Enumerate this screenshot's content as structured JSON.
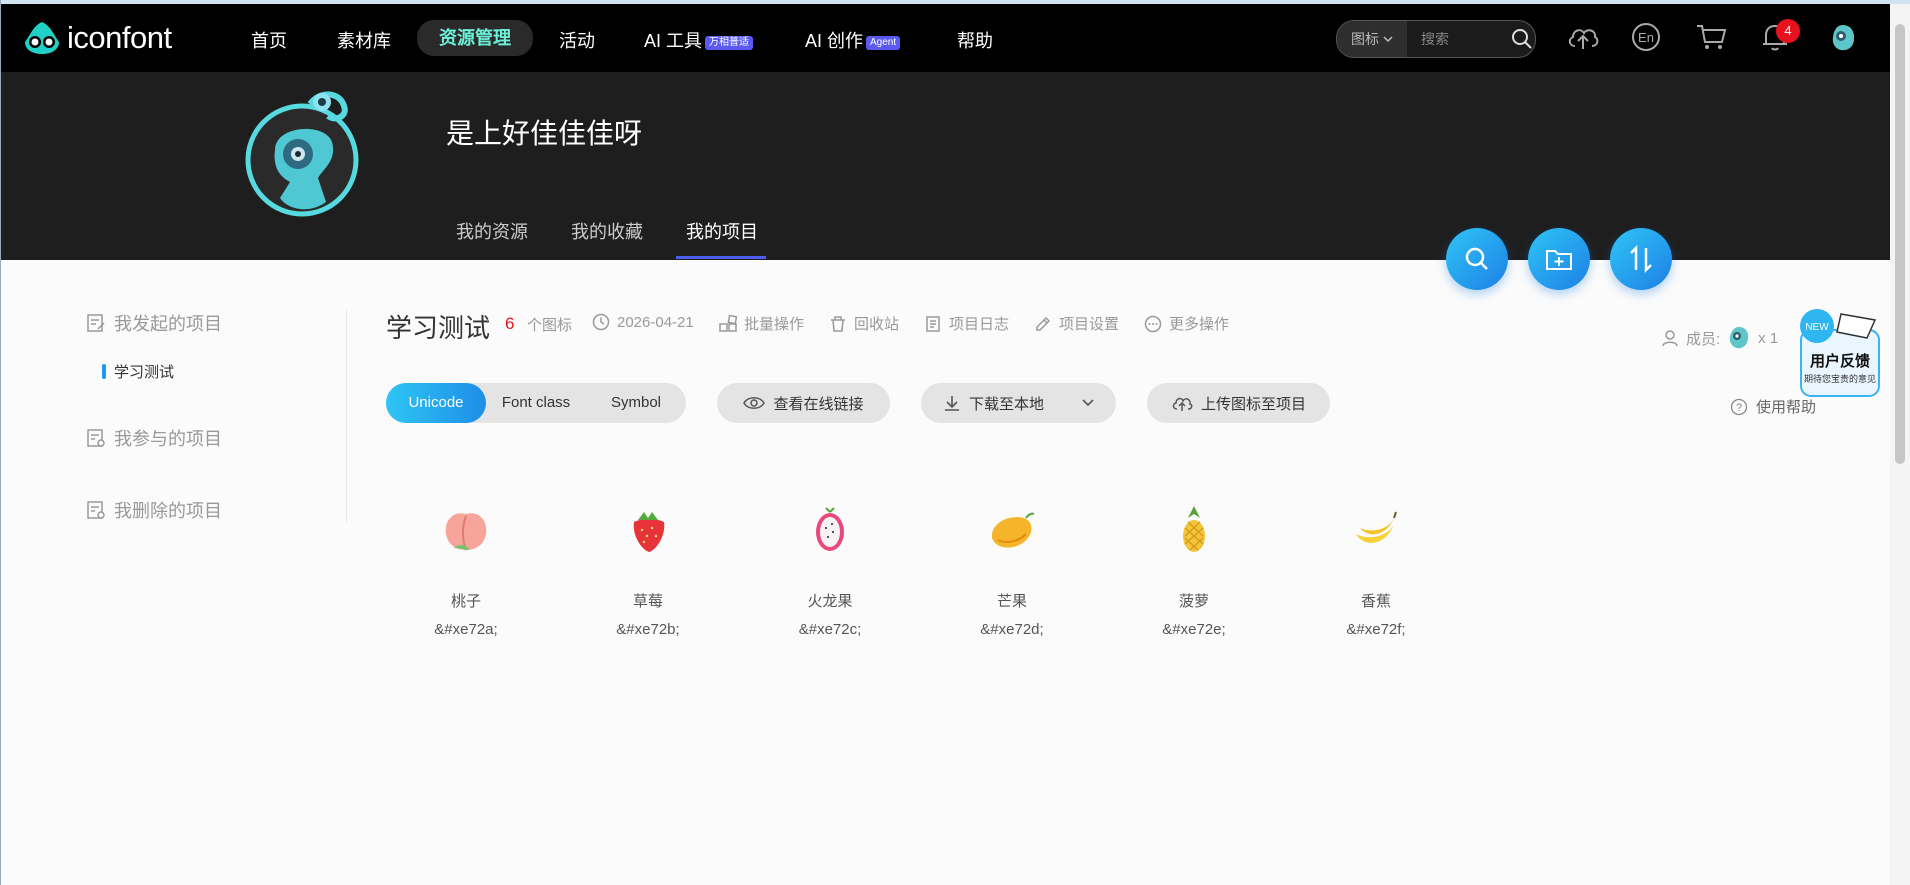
{
  "nav": {
    "logo_text": "iconfont",
    "items": [
      {
        "label": "首页"
      },
      {
        "label": "素材库"
      },
      {
        "label": "资源管理"
      },
      {
        "label": "活动"
      },
      {
        "label": "AI 工具",
        "badge": "万相普适"
      },
      {
        "label": "AI 创作",
        "badge": "Agent"
      },
      {
        "label": "帮助"
      }
    ],
    "search": {
      "type": "图标",
      "placeholder": "搜索"
    },
    "notification_count": "4",
    "icons": [
      "upload-cloud-icon",
      "language-en-icon",
      "cart-icon",
      "bell-icon",
      "avatar"
    ]
  },
  "profile": {
    "username": "是上好佳佳佳呀",
    "tabs": [
      {
        "label": "我的资源"
      },
      {
        "label": "我的收藏"
      },
      {
        "label": "我的项目"
      }
    ],
    "active_tab": "我的项目"
  },
  "sidebar": {
    "groups": [
      {
        "label": "我发起的项目",
        "items": [
          {
            "label": "学习测试"
          }
        ]
      },
      {
        "label": "我参与的项目"
      },
      {
        "label": "我删除的项目"
      }
    ]
  },
  "project": {
    "title": "学习测试",
    "icon_count": "6",
    "icon_count_label": "个图标",
    "date": "2026-04-21",
    "actions": [
      {
        "label": "批量操作",
        "icon": "batch-icon"
      },
      {
        "label": "回收站",
        "icon": "trash-icon"
      },
      {
        "label": "项目日志",
        "icon": "log-icon"
      },
      {
        "label": "项目设置",
        "icon": "edit-icon"
      },
      {
        "label": "更多操作",
        "icon": "more-icon"
      }
    ],
    "formats": [
      "Unicode",
      "Font class",
      "Symbol"
    ],
    "active_format": "Unicode",
    "buttons": {
      "view_link": "查看在线链接",
      "download": "下载至本地",
      "upload": "上传图标至项目"
    },
    "members_label": "成员:",
    "members_count": "x 1",
    "help": "使用帮助"
  },
  "feedback": {
    "tag": "NEW",
    "title": "用户反馈",
    "subtitle": "期待您宝贵的意见"
  },
  "icons": [
    {
      "name": "桃子",
      "code": "&#xe72a;"
    },
    {
      "name": "草莓",
      "code": "&#xe72b;"
    },
    {
      "name": "火龙果",
      "code": "&#xe72c;"
    },
    {
      "name": "芒果",
      "code": "&#xe72d;"
    },
    {
      "name": "菠萝",
      "code": "&#xe72e;"
    },
    {
      "name": "香蕉",
      "code": "&#xe72f;"
    }
  ],
  "colors": {
    "nav_bg": "#000000",
    "profile_bg": "#1e1e1e",
    "accent": "#1e9bf0",
    "active_nav": "#6cf0d8",
    "badge_red": "#e8121e"
  }
}
